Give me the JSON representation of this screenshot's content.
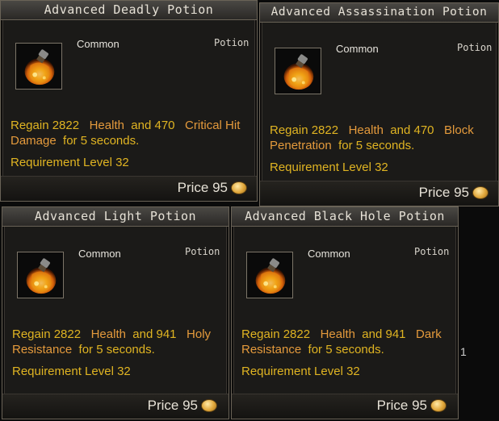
{
  "cards": [
    {
      "title": "Advanced Deadly Potion",
      "rarity": "Common",
      "type": "Potion",
      "desc": {
        "p1": "Regain 2822",
        "h1": "Health",
        "p2": "and 470",
        "h2": "Critical Hit",
        "h3": "Damage",
        "p3": "for 5 seconds."
      },
      "requirement": "Requirement Level 32",
      "price": "Price 95",
      "icon": "yellow-potion-icon"
    },
    {
      "title": "Advanced Assassination Potion",
      "rarity": "Common",
      "type": "Potion",
      "desc": {
        "p1": "Regain 2822",
        "h1": "Health",
        "p2": "and 470",
        "h2": "Block",
        "h3": "Penetration",
        "p3": "for 5 seconds."
      },
      "requirement": "Requirement Level 32",
      "price": "Price 95",
      "icon": "yellow-potion-icon"
    },
    {
      "title": "Advanced Light Potion",
      "rarity": "Common",
      "type": "Potion",
      "desc": {
        "p1": "Regain 2822",
        "h1": "Health",
        "p2": "and 941",
        "h2": "Holy",
        "h3": "Resistance",
        "p3": "for 5 seconds."
      },
      "requirement": "Requirement Level 32",
      "price": "Price 95",
      "icon": "yellow-potion-icon"
    },
    {
      "title": "Advanced Black Hole Potion",
      "rarity": "Common",
      "type": "Potion",
      "desc": {
        "p1": "Regain 2822",
        "h1": "Health",
        "p2": "and 941",
        "h2": "Dark",
        "h3": "Resistance",
        "p3": "for 5 seconds."
      },
      "requirement": "Requirement Level 32",
      "price": "Price 95",
      "icon": "yellow-potion-icon"
    }
  ],
  "edge_fragment": "1",
  "colors": {
    "gold_text": "#e0b422",
    "highlight_text": "#e49a3c",
    "panel_bg": "#1b1a18"
  }
}
